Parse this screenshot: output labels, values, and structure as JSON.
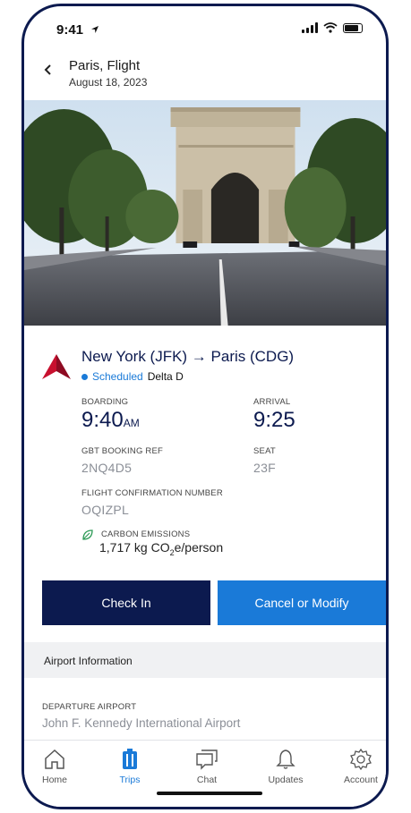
{
  "status_bar": {
    "time": "9:41",
    "location_arrow": "location-arrow-icon"
  },
  "header": {
    "title": "Paris, Flight",
    "date": "August 18, 2023",
    "back_icon": "chevron-left-icon"
  },
  "flight": {
    "route": "New York (JFK) → Paris (CDG)",
    "status": "Scheduled",
    "carrier": "Delta D",
    "boarding_label": "BOARDING",
    "boarding_time": "9:40",
    "boarding_suffix": "AM",
    "arrival_label": "ARRIVAL",
    "arrival_time": "9:25",
    "booking_ref_label": "GBT BOOKING REF",
    "booking_ref": "2NQ4D5",
    "seat_label": "SEAT",
    "seat": "23F",
    "confirmation_label": "FLIGHT CONFIRMATION NUMBER",
    "confirmation": "OQIZPL",
    "carbon_label": "CARBON EMISSIONS",
    "carbon_value": "1,717 kg CO",
    "carbon_sub": "2",
    "carbon_unit": "e/person"
  },
  "buttons": {
    "check_in": "Check In",
    "cancel_modify": "Cancel or Modify"
  },
  "airport": {
    "section_title": "Airport Information",
    "departure_label": "DEPARTURE AIRPORT",
    "departure_value": "John F. Kennedy International Airport"
  },
  "tabs": [
    {
      "label": "Home",
      "icon": "home-icon",
      "active": false
    },
    {
      "label": "Trips",
      "icon": "suitcase-icon",
      "active": true
    },
    {
      "label": "Chat",
      "icon": "chat-icon",
      "active": false
    },
    {
      "label": "Updates",
      "icon": "bell-icon",
      "active": false
    },
    {
      "label": "Account",
      "icon": "gear-icon",
      "active": false
    }
  ],
  "colors": {
    "navy": "#0c1a4f",
    "accent": "#1a7ad8",
    "delta_red": "#c8102e"
  }
}
